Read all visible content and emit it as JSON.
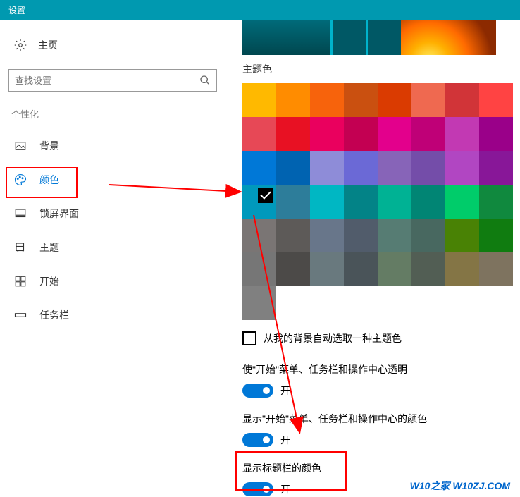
{
  "titlebar": {
    "title": "设置"
  },
  "sidebar": {
    "home": "主页",
    "search_placeholder": "查找设置",
    "category": "个性化",
    "items": [
      {
        "label": "背景"
      },
      {
        "label": "颜色"
      },
      {
        "label": "锁屏界面"
      },
      {
        "label": "主题"
      },
      {
        "label": "开始"
      },
      {
        "label": "任务栏"
      }
    ]
  },
  "main": {
    "accent_label": "主题色",
    "swatches": [
      "#ffb900",
      "#ff8c00",
      "#f7630c",
      "#ca5010",
      "#da3b01",
      "#ef6950",
      "#d13438",
      "#ff4343",
      "#e74856",
      "#e81123",
      "#ea005e",
      "#c30052",
      "#e3008c",
      "#bf0077",
      "#c239b3",
      "#9a0089",
      "#0078d7",
      "#0063b1",
      "#8e8cd8",
      "#6b69d6",
      "#8764b8",
      "#744da9",
      "#b146c2",
      "#881798",
      "#0099bc",
      "#2d7d9a",
      "#00b7c3",
      "#038387",
      "#00b294",
      "#018574",
      "#00cc6a",
      "#10893e",
      "#7a7574",
      "#5d5a58",
      "#68768a",
      "#515c6b",
      "#567c73",
      "#486860",
      "#498205",
      "#107c10",
      "#767676",
      "#4c4a48",
      "#69797e",
      "#4a5459",
      "#647c64",
      "#525e54",
      "#847545",
      "#7e735f",
      "#808080"
    ],
    "selected_swatch_index": 24,
    "auto_pick_label": "从我的背景自动选取一种主题色",
    "toggles": [
      {
        "label": "使\"开始\"菜单、任务栏和操作中心透明",
        "state": "开"
      },
      {
        "label": "显示\"开始\"菜单、任务栏和操作中心的颜色",
        "state": "开"
      },
      {
        "label": "显示标题栏的颜色",
        "state": "开"
      }
    ]
  },
  "watermark": "W10之家 W10ZJ.COM"
}
